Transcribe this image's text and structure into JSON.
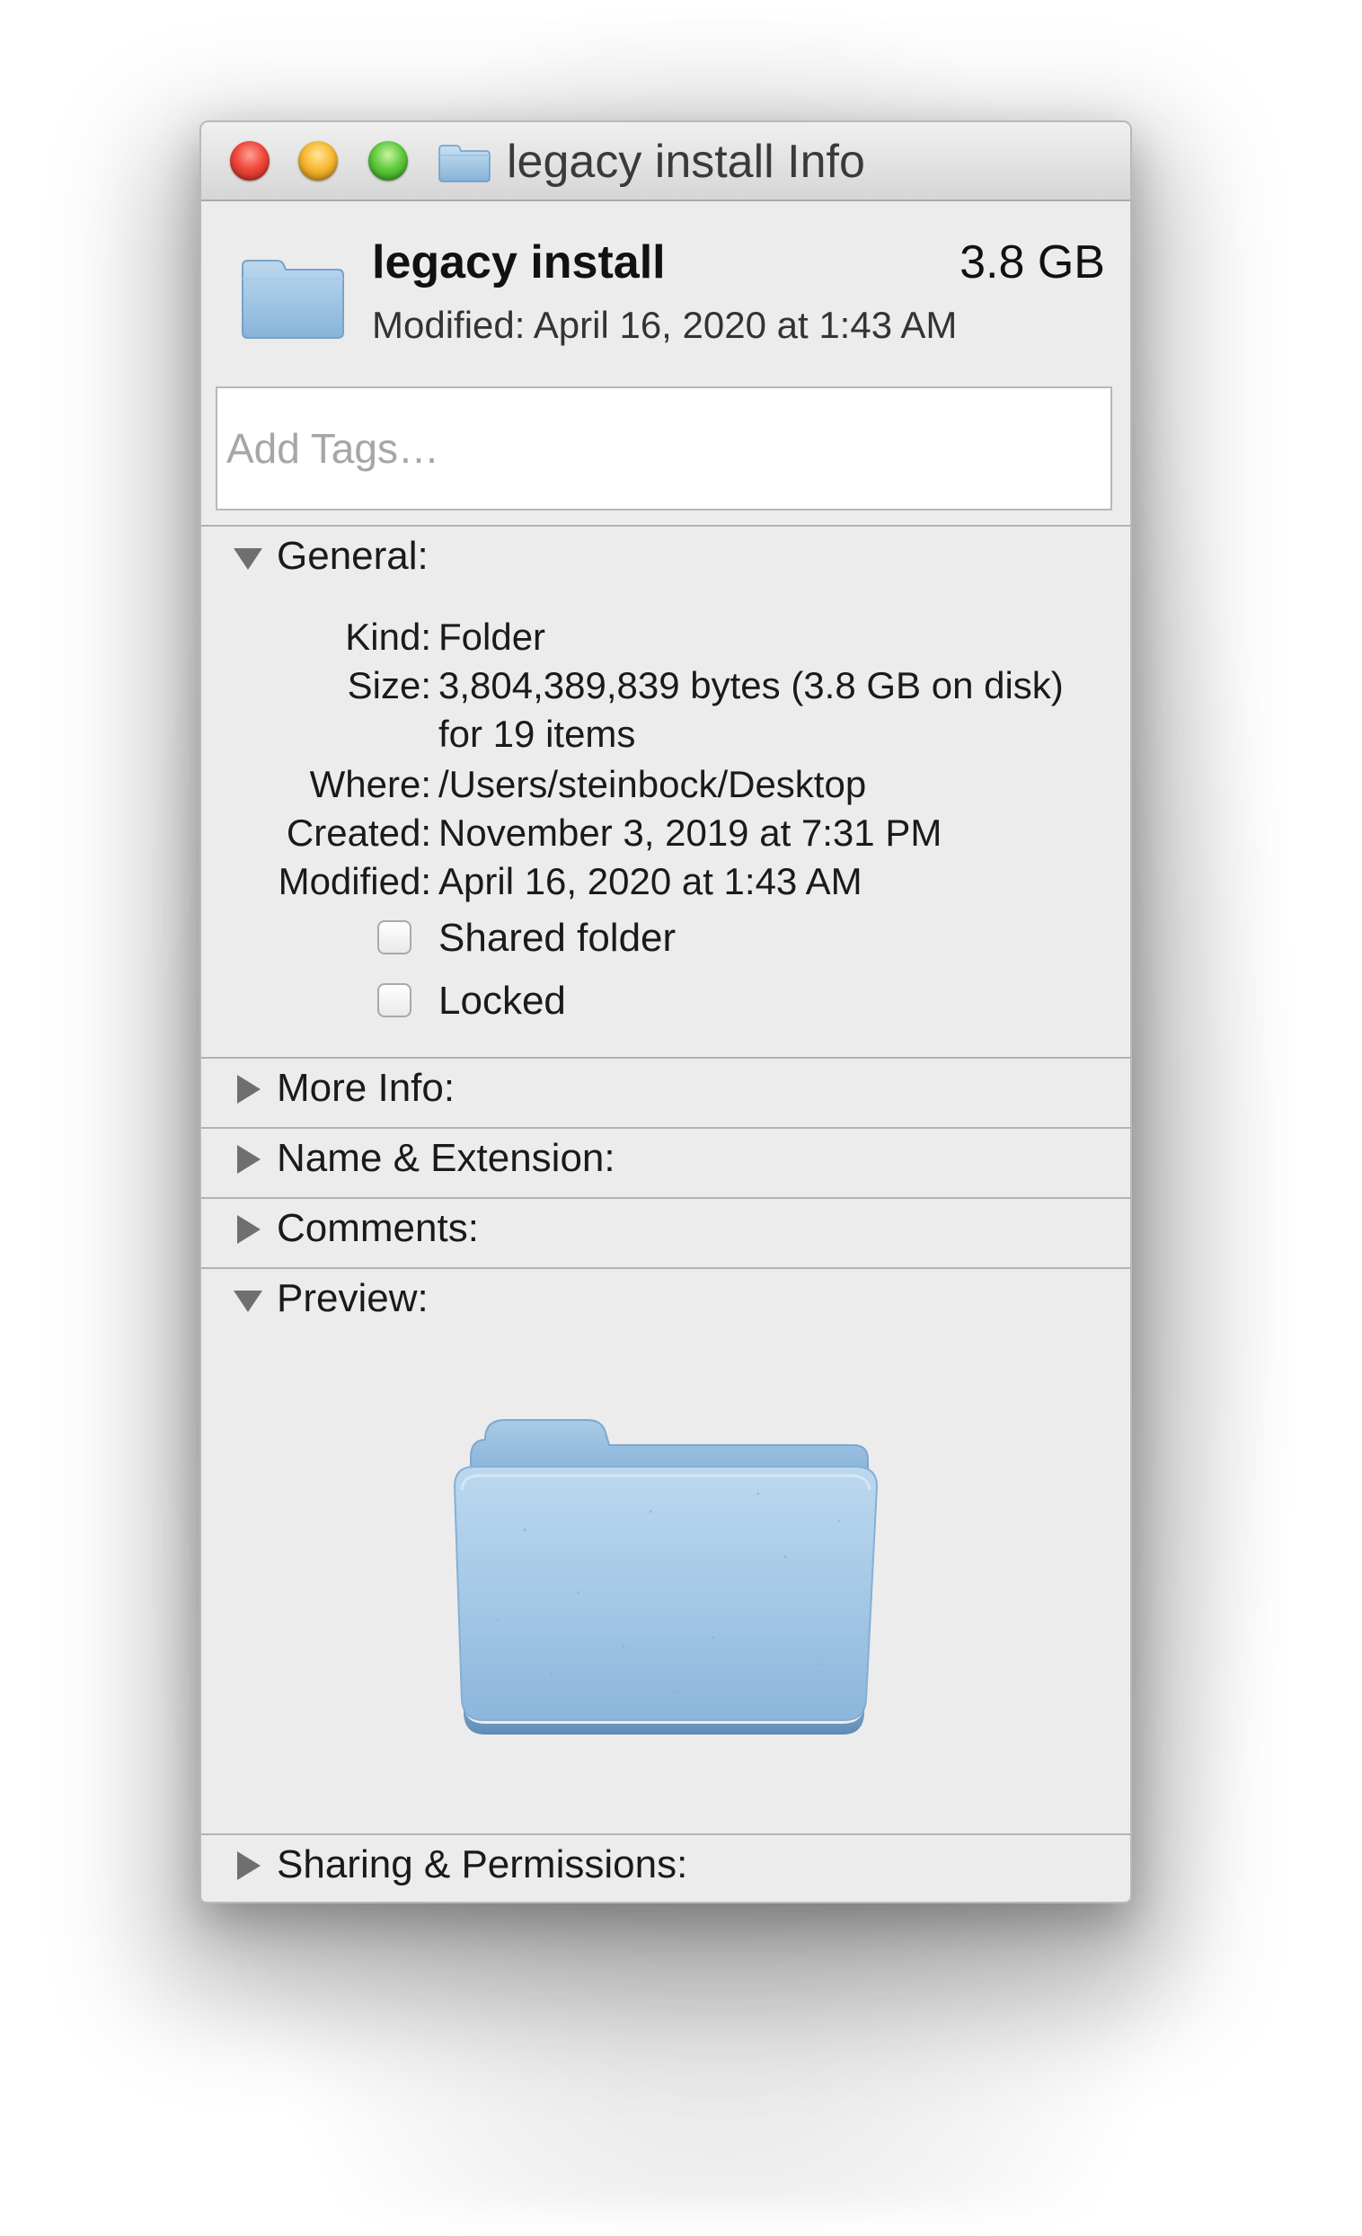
{
  "window": {
    "title": "legacy install Info",
    "title_icon": "folder-icon"
  },
  "header": {
    "name": "legacy install",
    "size": "3.8 GB",
    "modified": "Modified: April 16, 2020 at 1:43 AM"
  },
  "tags": {
    "placeholder": "Add Tags…",
    "value": ""
  },
  "general": {
    "label": "General:",
    "expanded": true,
    "rows": [
      {
        "key": "Kind:",
        "value": "Folder"
      },
      {
        "key": "Size:",
        "value": "3,804,389,839 bytes (3.8 GB on disk) for 19 items"
      },
      {
        "key": "Where:",
        "value": "/Users/steinbock/Desktop"
      },
      {
        "key": "Created:",
        "value": "November 3, 2019 at 7:31 PM"
      },
      {
        "key": "Modified:",
        "value": "April 16, 2020 at 1:43 AM"
      }
    ],
    "checkboxes": [
      {
        "label": "Shared folder",
        "checked": false
      },
      {
        "label": "Locked",
        "checked": false
      }
    ]
  },
  "sections": {
    "more_info": {
      "label": "More Info:",
      "expanded": false
    },
    "name_extension": {
      "label": "Name & Extension:",
      "expanded": false
    },
    "comments": {
      "label": "Comments:",
      "expanded": false
    },
    "preview": {
      "label": "Preview:",
      "expanded": true
    },
    "sharing": {
      "label": "Sharing & Permissions:",
      "expanded": false
    }
  },
  "colors": {
    "folder_light": "#b9d6ec",
    "folder_mid": "#8fb9dd",
    "folder_dark": "#6e9cc5"
  }
}
